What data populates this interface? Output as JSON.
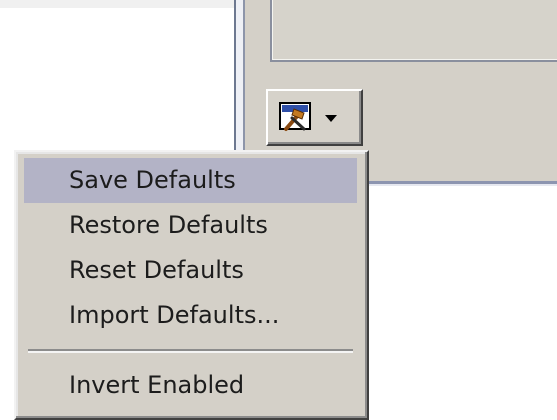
{
  "toolbar": {
    "tool_button_icon": "hammer-wrench-icon",
    "dropdown_icon": "chevron-down-icon"
  },
  "menu": {
    "items": [
      {
        "label": "Save Defaults",
        "selected": true
      },
      {
        "label": "Restore Defaults",
        "selected": false
      },
      {
        "label": "Reset Defaults",
        "selected": false
      },
      {
        "label": "Import Defaults...",
        "selected": false
      },
      {
        "label": "Invert Enabled",
        "selected": false
      }
    ],
    "highlight_color": "#b3b3c6"
  },
  "colors": {
    "panel": "#d4d0c8",
    "separator": "#6d7890"
  }
}
